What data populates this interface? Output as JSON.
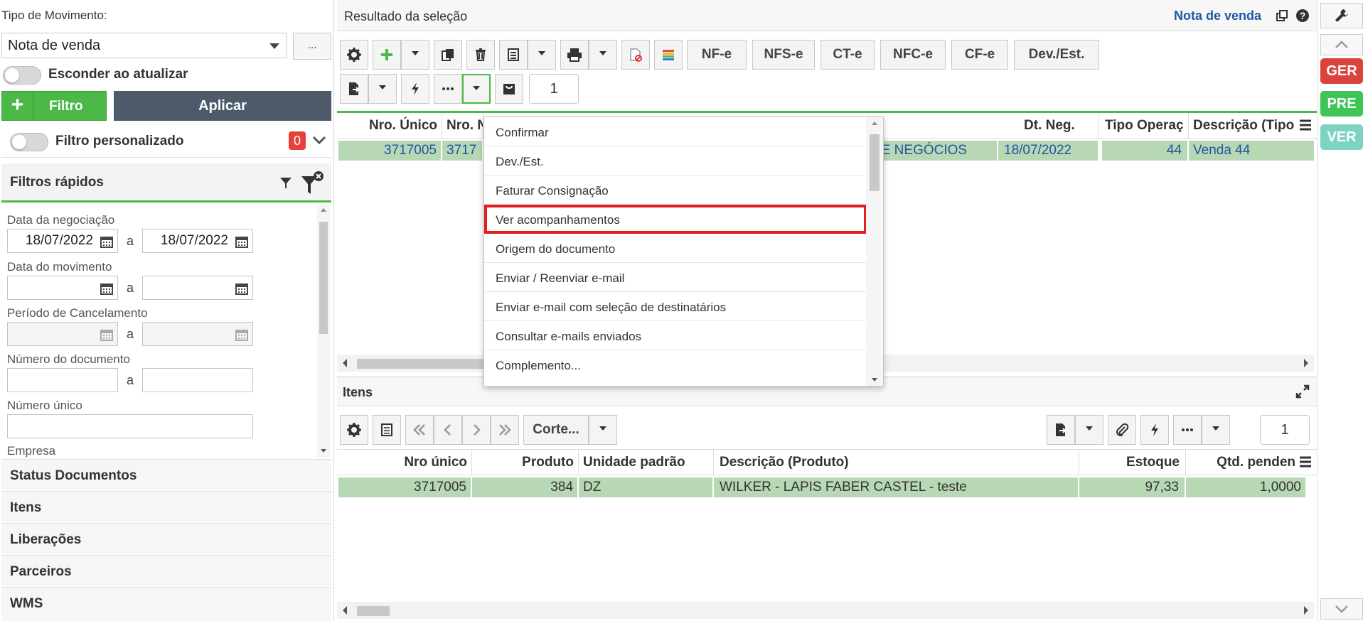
{
  "left": {
    "movement_label": "Tipo de Movimento:",
    "movement_value": "Nota de venda",
    "dots": "...",
    "hide_on_update": "Esconder ao atualizar",
    "filter_btn": "Filtro",
    "apply_btn": "Aplicar",
    "custom_filter": "Filtro personalizado",
    "custom_filter_count": "0",
    "quick_filters_title": "Filtros rápidos",
    "fields": {
      "data_negociacao": "Data da negociação",
      "data_movimento": "Data do movimento",
      "periodo_cancelamento": "Período de Cancelamento",
      "numero_documento": "Número do documento",
      "numero_unico": "Número único",
      "empresa": "Empresa"
    },
    "date_from": "18/07/2022",
    "date_to": "18/07/2022",
    "a": "a",
    "accordions": [
      "Status Documentos",
      "Itens",
      "Liberações",
      "Parceiros",
      "WMS"
    ]
  },
  "main": {
    "title": "Resultado da seleção",
    "movement_link": "Nota de venda",
    "text_buttons": [
      "NF-e",
      "NFS-e",
      "CT-e",
      "NFC-e",
      "CF-e",
      "Dev./Est."
    ],
    "page_counter": "1",
    "grid1": {
      "headers": [
        "Nro. Único",
        "Nro. N",
        "Dt. Neg.",
        "Tipo Operaç",
        "Descrição (Tipo"
      ],
      "row": [
        "3717005",
        "3717",
        "DE NEGÓCIOS",
        "18/07/2022",
        "44",
        "Venda 44"
      ]
    },
    "itens": {
      "title": "Itens",
      "corte": "Corte...",
      "page_counter": "1",
      "headers": [
        "Nro único",
        "Produto",
        "Unidade padrão",
        "Descrição (Produto)",
        "Estoque",
        "Qtd. penden"
      ],
      "row": [
        "3717005",
        "384",
        "DZ",
        "WILKER - LAPIS FABER CASTEL - teste",
        "97,33",
        "1,0000"
      ]
    }
  },
  "menu": {
    "items": [
      "Confirmar",
      "Dev./Est.",
      "Faturar Consignação",
      "Ver acompanhamentos",
      "Origem do documento",
      "Enviar / Reenviar e-mail",
      "Enviar e-mail com seleção de destinatários",
      "Consultar e-mails enviados",
      "Complemento..."
    ],
    "selected_index": 3
  },
  "sidebar": {
    "tags": [
      "GER",
      "PRE",
      "VER"
    ],
    "colors": {
      "GER": "#d9433c",
      "PRE": "#3fc456",
      "VER": "#7dd3c3"
    }
  },
  "colors": {
    "accent_green": "#4cb848",
    "row_green": "#b8d7b4",
    "dark_btn": "#4d5a69",
    "link_blue": "#1f57a2",
    "highlight_red": "#e21f1f"
  }
}
